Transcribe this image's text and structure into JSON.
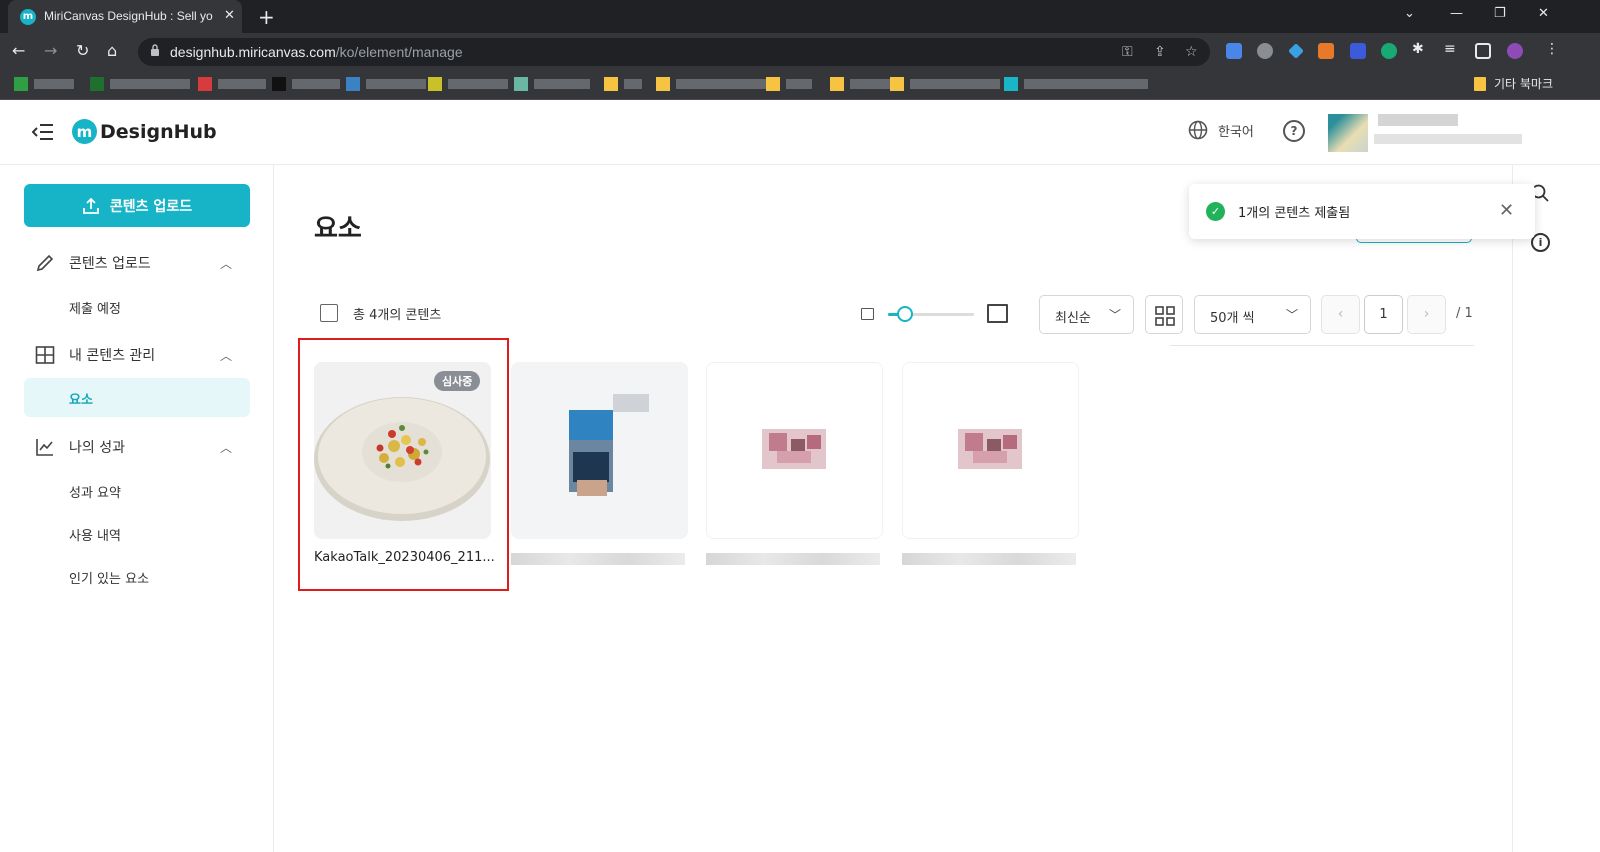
{
  "browser": {
    "tab_title": "MiriCanvas DesignHub : Sell yo",
    "tab_favicon_letter": "m",
    "url_host": "designhub.miricanvas.com",
    "url_path": "/ko/element/manage",
    "bookmark_other": "기타 북마크"
  },
  "header": {
    "logo_letter": "m",
    "logo_text": "DesignHub",
    "language": "한국어"
  },
  "sidebar": {
    "upload_button": "콘텐츠 업로드",
    "sections": [
      {
        "label": "콘텐츠 업로드",
        "items": [
          "제출 예정"
        ]
      },
      {
        "label": "내 콘텐츠 관리",
        "items": [
          "요소"
        ]
      },
      {
        "label": "나의 성과",
        "items": [
          "성과 요약",
          "사용 내역",
          "인기 있는 요소"
        ]
      }
    ]
  },
  "main": {
    "title": "요소",
    "total_count": "총 4개의 콘텐츠",
    "thumbnail_size_level": 0.2,
    "sort": "최신순",
    "per_page": "50개 씩",
    "page_current": "1",
    "page_total": "/ 1",
    "cards": [
      {
        "caption": "KakaoTalk_20230406_211...",
        "badge": "심사중"
      }
    ]
  },
  "toast": {
    "message": "1개의 콘텐츠 제출됨"
  },
  "colors": {
    "accent": "#17b3c6",
    "success": "#22b35a",
    "highlight": "#e01b1b"
  }
}
